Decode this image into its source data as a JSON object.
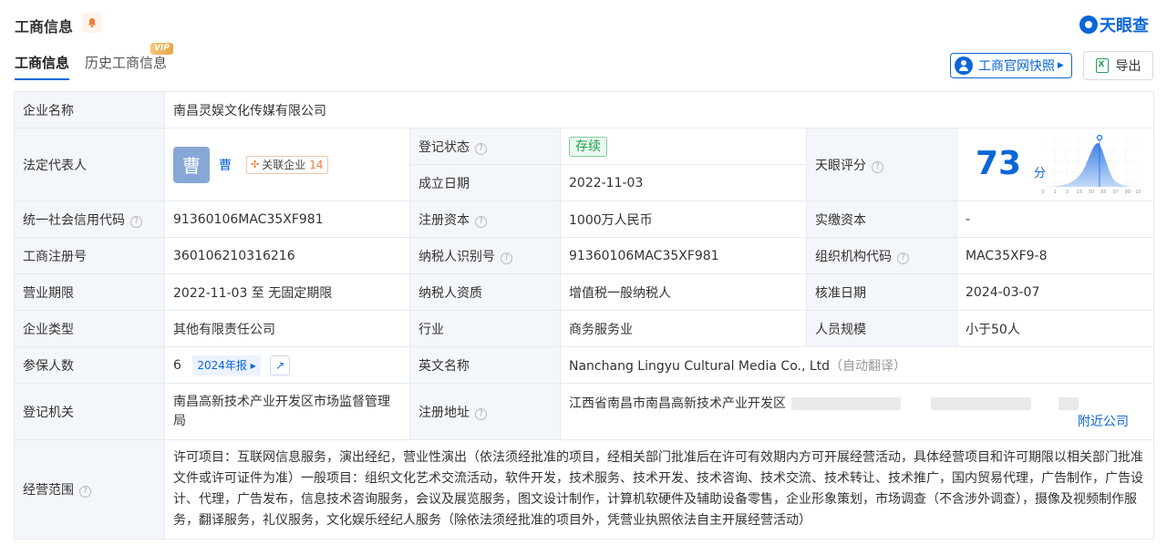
{
  "header": {
    "title": "工商信息",
    "logo_text": "天眼查"
  },
  "tabs": [
    {
      "label": "工商信息"
    },
    {
      "label": "历史工商信息",
      "badge": "VIP"
    }
  ],
  "actions": {
    "snapshot_label": "工商官网快照",
    "export_label": "导出"
  },
  "company": {
    "name_label": "企业名称",
    "name": "南昌灵娱文化传媒有限公司",
    "rep_label": "法定代表人",
    "rep_avatar": "曹",
    "rep_name": "曹",
    "related_label": "关联企业",
    "related_count": "14",
    "status_label": "登记状态",
    "status": "存续",
    "found_label": "成立日期",
    "found_date": "2022-11-03",
    "score_label": "天眼评分",
    "score": "73",
    "score_unit": "分",
    "credit_label": "统一社会信用代码",
    "credit_code": "91360106MAC35XF981",
    "capital_label": "注册资本",
    "capital": "1000万人民币",
    "paid_label": "实缴资本",
    "paid": "-",
    "regno_label": "工商注册号",
    "regno": "360106210316216",
    "taxid_label": "纳税人识别号",
    "taxid": "91360106MAC35XF981",
    "orgcode_label": "组织机构代码",
    "orgcode": "MAC35XF9-8",
    "period_label": "营业期限",
    "period": "2022-11-03 至 无固定期限",
    "taxqual_label": "纳税人资质",
    "taxqual": "增值税一般纳税人",
    "approve_label": "核准日期",
    "approve_date": "2024-03-07",
    "type_label": "企业类型",
    "type": "其他有限责任公司",
    "industry_label": "行业",
    "industry": "商务服务业",
    "staff_label": "人员规模",
    "staff": "小于50人",
    "insured_label": "参保人数",
    "insured": "6",
    "report_year": "2024年报",
    "en_label": "英文名称",
    "en_name": "Nanchang Lingyu Cultural Media Co., Ltd",
    "en_note": "（自动翻译）",
    "authority_label": "登记机关",
    "authority": "南昌高新技术产业开发区市场监督管理局",
    "address_label": "注册地址",
    "address": "江西省南昌市南昌高新技术产业开发区",
    "nearby": "附近公司",
    "scope_label": "经营范围",
    "scope": "许可项目：互联网信息服务，演出经纪，营业性演出（依法须经批准的项目，经相关部门批准后在许可有效期内方可开展经营活动，具体经营项目和许可期限以相关部门批准文件或许可证件为准）一般项目：组织文化艺术交流活动，软件开发，技术服务、技术开发、技术咨询、技术交流、技术转让、技术推广，国内贸易代理，广告制作，广告设计、代理，广告发布，信息技术咨询服务，会议及展览服务，图文设计制作，计算机软硬件及辅助设备零售，企业形象策划，市场调查（不含涉外调查），摄像及视频制作服务，翻译服务，礼仪服务，文化娱乐经纪人服务（除依法须经批准的项目外，凭营业执照依法自主开展经营活动）"
  },
  "score_chart": {
    "x_ticks": [
      "0",
      "1",
      "3",
      "15",
      "50",
      "85",
      "97",
      "99",
      "100"
    ]
  },
  "colors": {
    "accent": "#0a66d8",
    "status_green": "#1f9d4b",
    "label_bg": "#f3f6fa"
  }
}
